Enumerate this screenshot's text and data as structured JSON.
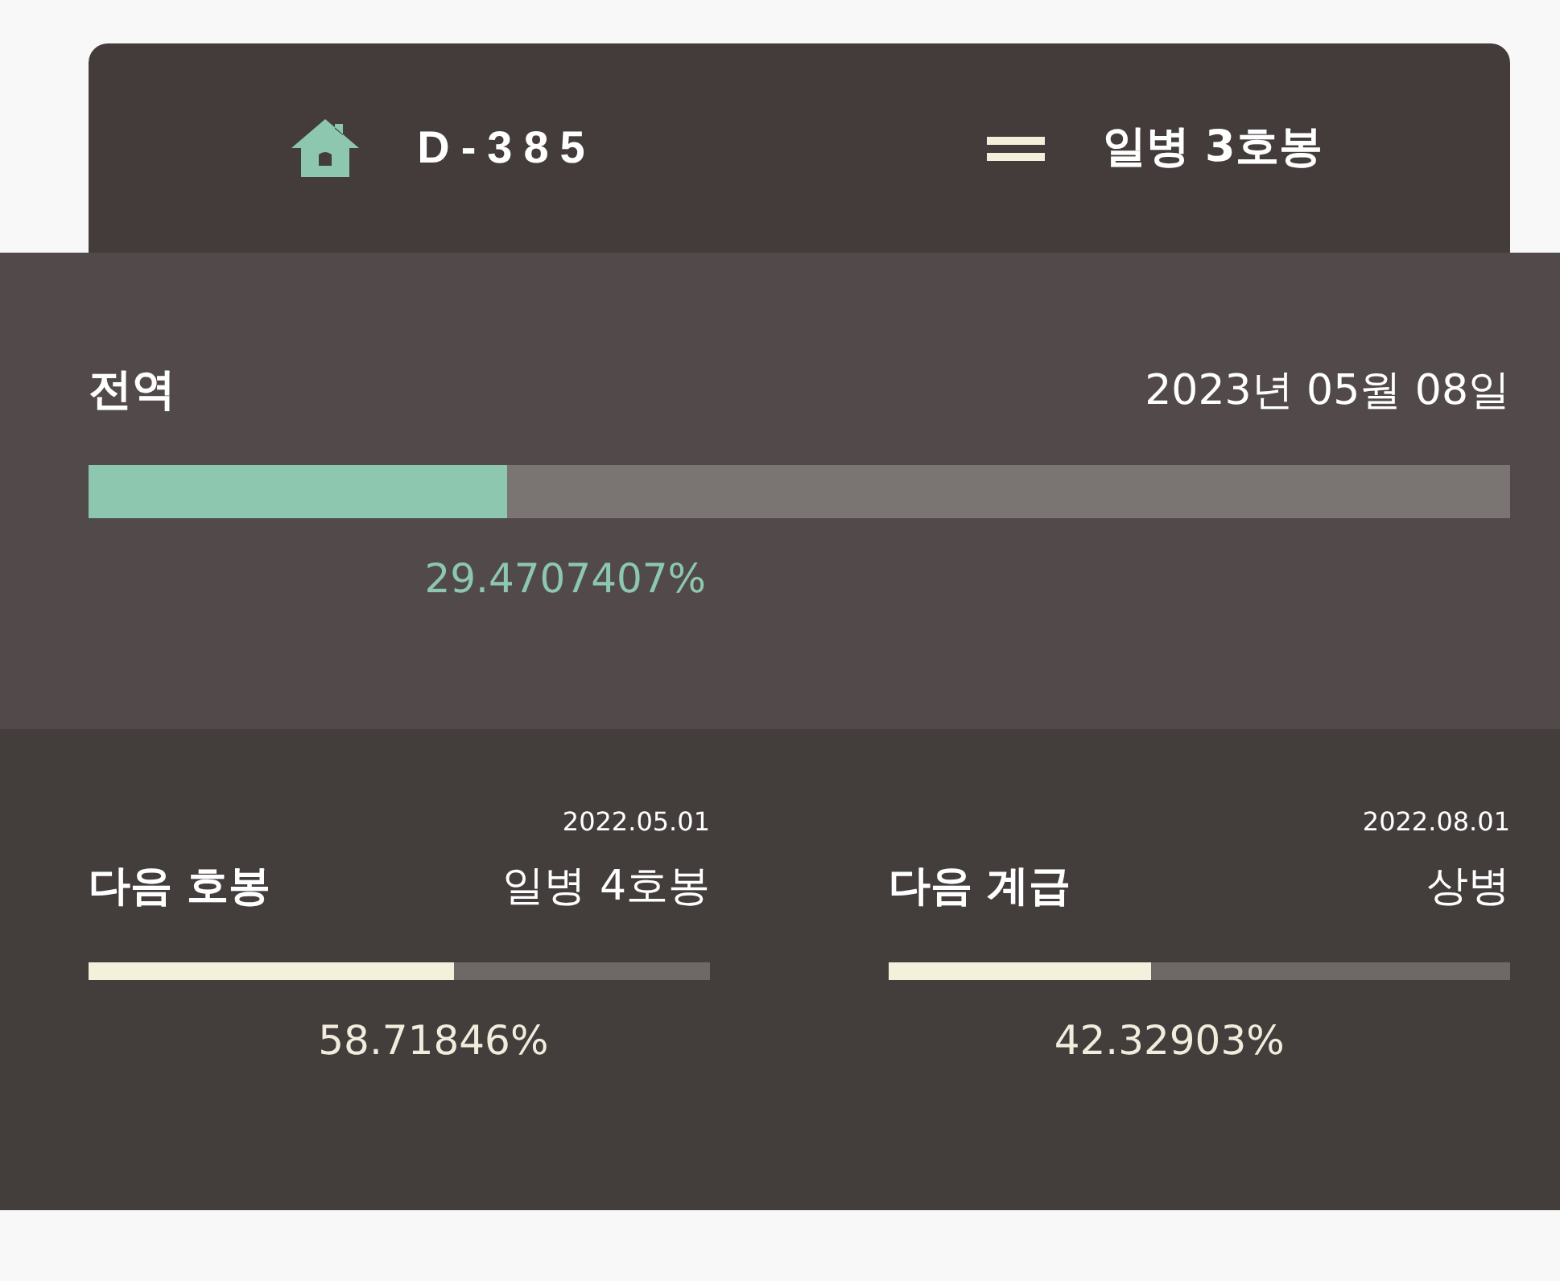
{
  "header": {
    "dday": "D-385",
    "rank": "일병 3호봉"
  },
  "discharge": {
    "label": "전역",
    "date": "2023년 05월 08일",
    "level": 0.2947,
    "percent": "29.4707407%"
  },
  "next": [
    {
      "date": "2022.05.01",
      "label": "다음 호봉",
      "value": "일병 4호봉",
      "level": 0.5872,
      "percent": "58.71846%"
    },
    {
      "date": "2022.08.01",
      "label": "다음 계급",
      "value": "상병",
      "level": 0.4233,
      "percent": "42.32903%"
    }
  ]
}
